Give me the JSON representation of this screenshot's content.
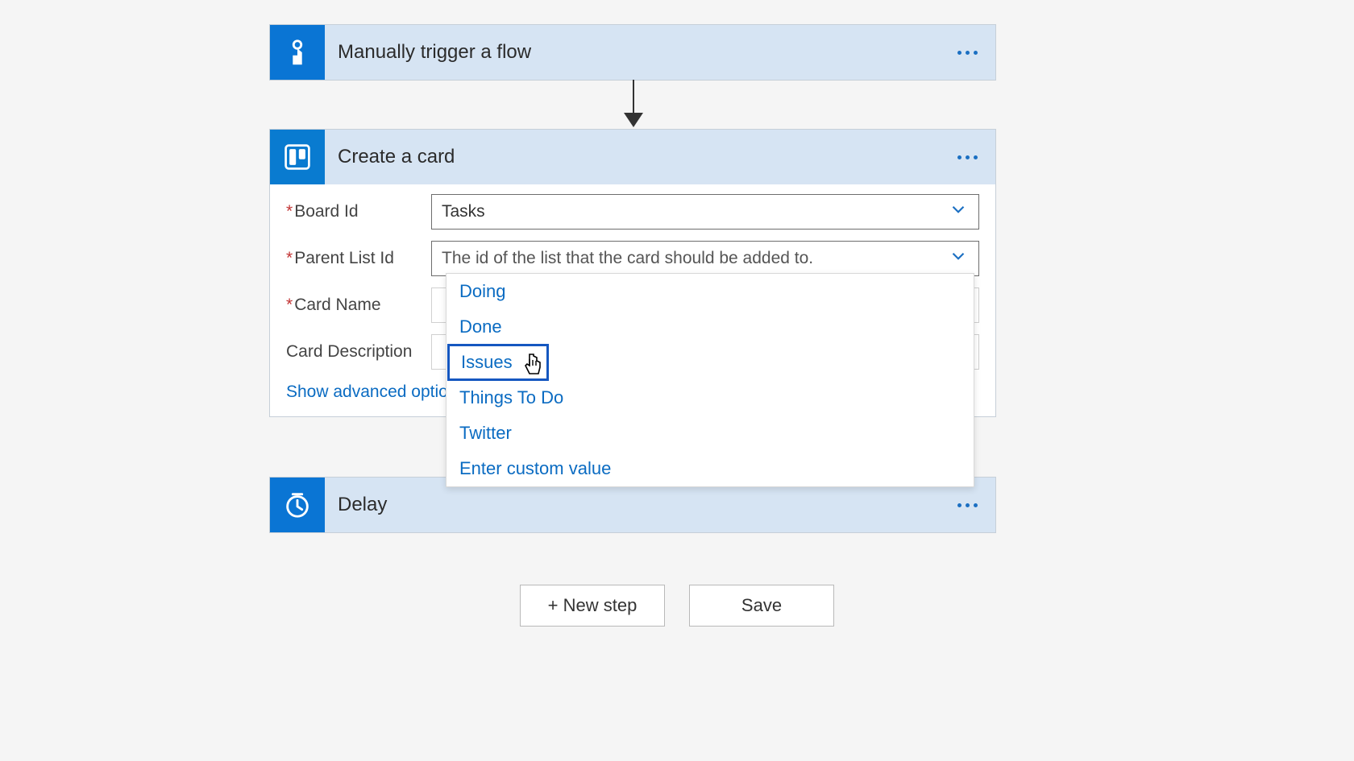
{
  "trigger": {
    "title": "Manually trigger a flow"
  },
  "createCard": {
    "title": "Create a card",
    "fields": {
      "boardId": {
        "label": "Board Id",
        "value": "Tasks",
        "required": true
      },
      "parentListId": {
        "label": "Parent List Id",
        "placeholder": "The id of the list that the card should be added to.",
        "required": true
      },
      "cardName": {
        "label": "Card Name",
        "required": true
      },
      "cardDescription": {
        "label": "Card Description",
        "required": false
      }
    },
    "advancedLink": "Show advanced options"
  },
  "dropdown": {
    "options": [
      "Doing",
      "Done",
      "Issues",
      "Things To Do",
      "Twitter",
      "Enter custom value"
    ],
    "highlighted": "Issues"
  },
  "delay": {
    "title": "Delay"
  },
  "buttons": {
    "newStep": "+ New step",
    "save": "Save"
  }
}
